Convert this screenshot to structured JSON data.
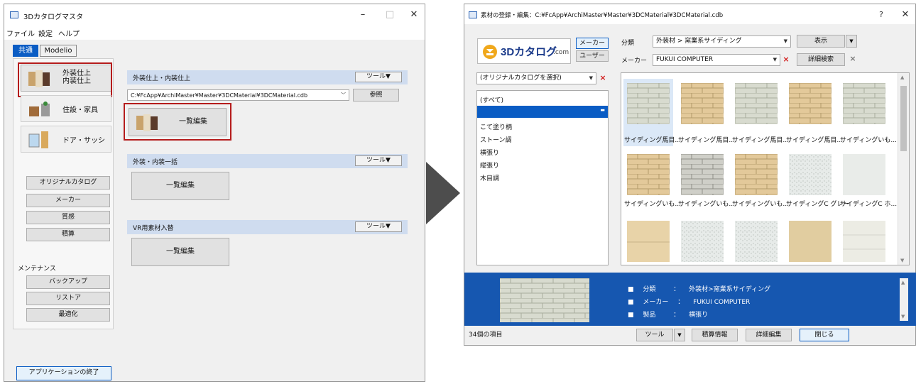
{
  "left_window": {
    "title": "3Dカタログマスタ",
    "controls": {
      "minimize": "–",
      "maximize": "□",
      "close": "✕"
    },
    "menu": [
      "ファイル",
      "設定",
      "ヘルプ"
    ],
    "tabs": [
      "共通",
      "Modelio"
    ],
    "categories": [
      "外装仕上\n内装仕上",
      "住設・家具",
      "ドア・サッシ"
    ],
    "left_buttons": [
      "オリジナルカタログ",
      "メーカー",
      "質感",
      "積算"
    ],
    "maintenance_label": "メンテナンス",
    "maintenance_buttons": [
      "バックアップ",
      "リストア",
      "最適化"
    ],
    "exit_button": "アプリケーションの終了",
    "sections": [
      {
        "title": "外装仕上・内装仕上",
        "tool": "ツール▼"
      },
      {
        "title": "外装・内装一括",
        "tool": "ツール▼"
      },
      {
        "title": "VR用素材入替",
        "tool": "ツール▼"
      }
    ],
    "path_value": "C:¥FcApp¥ArchiMaster¥Master¥3DCMaterial¥3DCMaterial.cdb",
    "browse_button": "参照",
    "bulk_edit": "一覧編集"
  },
  "right_window": {
    "title": "素材の登録・編集：C:¥FcApp¥ArchiMaster¥Master¥3DCMaterial¥3DCMaterial.cdb",
    "controls": {
      "help": "?",
      "close": "✕"
    },
    "logo_text": "3Dカタログ",
    "logo_suffix": ".com",
    "maker_button": "メーカー",
    "user_button": "ユーザー",
    "category_label": "分類",
    "category_value": "外装材 > 窯業系サイディング",
    "display_button": "表示",
    "maker_label": "メーカー",
    "maker_value": "FUKUI COMPUTER",
    "detail_search": "詳細検索",
    "catalog_select": "(オリジナルカタログを選択)",
    "list_items": [
      "(すべて)",
      "",
      "こて塗り柄",
      "ストーン調",
      "横張り",
      "縦張り",
      "木目調"
    ],
    "tile_labels": [
      "サイディング馬目...",
      "サイディング馬目...",
      "サイディング馬目...",
      "サイディング馬目...",
      "サイディングいも...",
      "サイディングいも...",
      "サイディングいも...",
      "サイディングいも...",
      "サイディングC グレー",
      "サイディングC ホ..."
    ],
    "info": {
      "row1_key": "分類",
      "row1_val": "外装材>窯業系サイディング",
      "row2_key": "メーカー",
      "row2_val": "FUKUI COMPUTER",
      "row3_key": "製品",
      "row3_val": "横張り",
      "separator": "：",
      "bullet": "■"
    },
    "item_count": "34個の項目",
    "footer_buttons": {
      "tool": "ツール",
      "estimate": "積算情報",
      "detail_edit": "詳細編集",
      "close": "閉じる"
    }
  },
  "colors": {
    "accent": "#0a5cc4",
    "highlight": "#b51c1c",
    "info_bg": "#1657b0"
  }
}
